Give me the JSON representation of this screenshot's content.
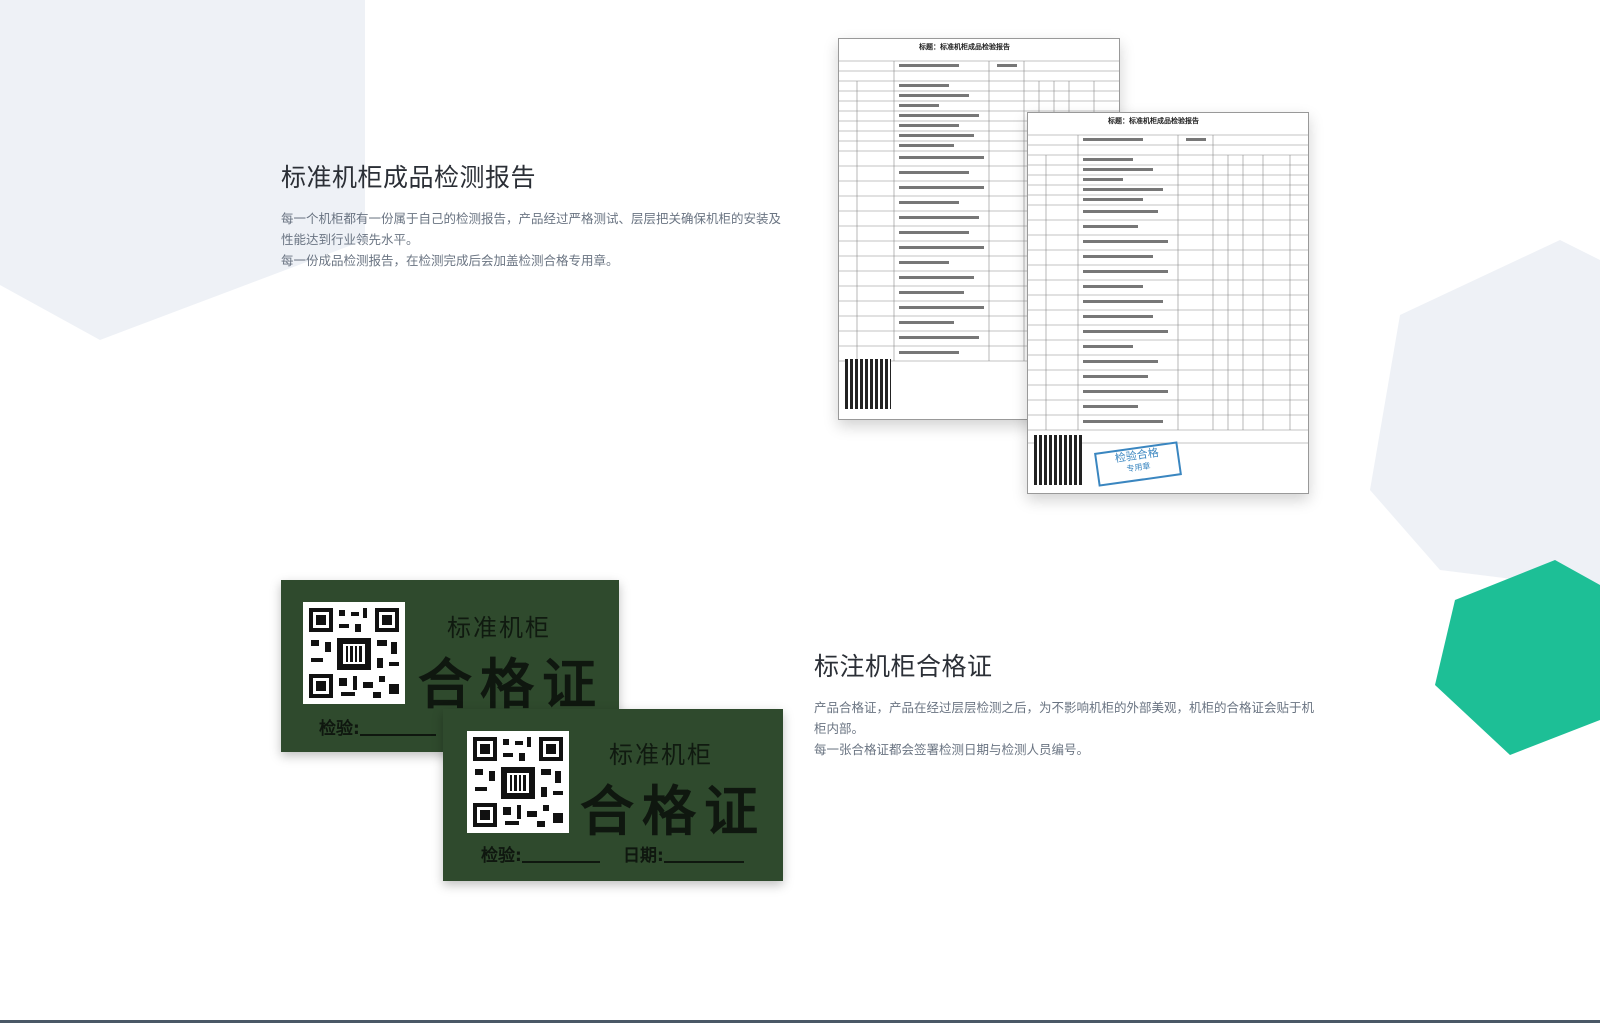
{
  "report": {
    "title": "标准机柜成品检测报告",
    "desc": [
      "每一个机柜都有一份属于自己的检测报告，产品经过严格测试、层层把关确保机柜的安装及性能达到行业领先水平。",
      "每一份成品检测报告，在检测完成后会加盖检测合格专用章。"
    ],
    "doc_title": "标题：标准机柜成品检验报告",
    "stamp_text": "检验合格",
    "stamp_sub": "专用章"
  },
  "certificate": {
    "title": "标注机柜合格证",
    "desc": [
      "产品合格证，产品在经过层层检测之后，为不影响机柜的外部美观，机柜的合格证会贴于机柜内部。",
      "每一张合格证都会签署检测日期与检测人员编号。"
    ],
    "card_sub": "标准机柜",
    "card_main": "合格证",
    "inspect_label": "检验:",
    "date_label": "日期:"
  },
  "colors": {
    "accent": "#1dbf96",
    "cert_bg": "#2f4a2d",
    "shape_light": "#eef1f6"
  }
}
